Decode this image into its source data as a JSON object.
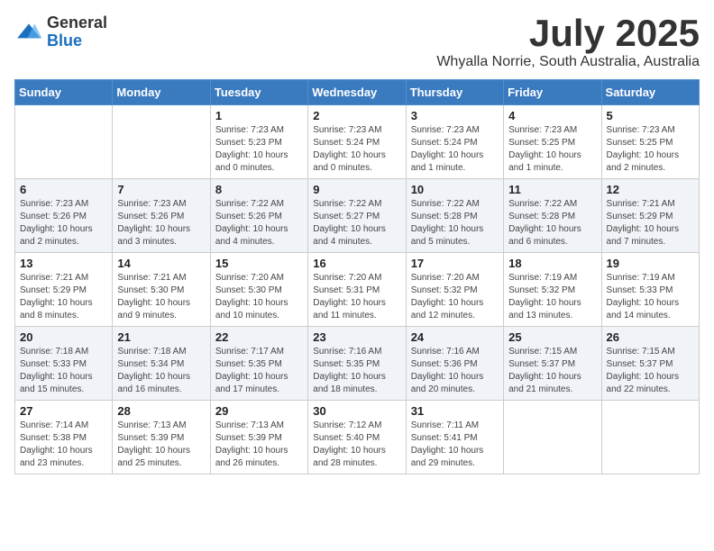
{
  "logo": {
    "general": "General",
    "blue": "Blue"
  },
  "title": {
    "month_year": "July 2025",
    "location": "Whyalla Norrie, South Australia, Australia"
  },
  "weekdays": [
    "Sunday",
    "Monday",
    "Tuesday",
    "Wednesday",
    "Thursday",
    "Friday",
    "Saturday"
  ],
  "weeks": [
    [
      {
        "day": "",
        "sunrise": "",
        "sunset": "",
        "daylight": ""
      },
      {
        "day": "",
        "sunrise": "",
        "sunset": "",
        "daylight": ""
      },
      {
        "day": "1",
        "sunrise": "Sunrise: 7:23 AM",
        "sunset": "Sunset: 5:23 PM",
        "daylight": "Daylight: 10 hours and 0 minutes."
      },
      {
        "day": "2",
        "sunrise": "Sunrise: 7:23 AM",
        "sunset": "Sunset: 5:24 PM",
        "daylight": "Daylight: 10 hours and 0 minutes."
      },
      {
        "day": "3",
        "sunrise": "Sunrise: 7:23 AM",
        "sunset": "Sunset: 5:24 PM",
        "daylight": "Daylight: 10 hours and 1 minute."
      },
      {
        "day": "4",
        "sunrise": "Sunrise: 7:23 AM",
        "sunset": "Sunset: 5:25 PM",
        "daylight": "Daylight: 10 hours and 1 minute."
      },
      {
        "day": "5",
        "sunrise": "Sunrise: 7:23 AM",
        "sunset": "Sunset: 5:25 PM",
        "daylight": "Daylight: 10 hours and 2 minutes."
      }
    ],
    [
      {
        "day": "6",
        "sunrise": "Sunrise: 7:23 AM",
        "sunset": "Sunset: 5:26 PM",
        "daylight": "Daylight: 10 hours and 2 minutes."
      },
      {
        "day": "7",
        "sunrise": "Sunrise: 7:23 AM",
        "sunset": "Sunset: 5:26 PM",
        "daylight": "Daylight: 10 hours and 3 minutes."
      },
      {
        "day": "8",
        "sunrise": "Sunrise: 7:22 AM",
        "sunset": "Sunset: 5:26 PM",
        "daylight": "Daylight: 10 hours and 4 minutes."
      },
      {
        "day": "9",
        "sunrise": "Sunrise: 7:22 AM",
        "sunset": "Sunset: 5:27 PM",
        "daylight": "Daylight: 10 hours and 4 minutes."
      },
      {
        "day": "10",
        "sunrise": "Sunrise: 7:22 AM",
        "sunset": "Sunset: 5:28 PM",
        "daylight": "Daylight: 10 hours and 5 minutes."
      },
      {
        "day": "11",
        "sunrise": "Sunrise: 7:22 AM",
        "sunset": "Sunset: 5:28 PM",
        "daylight": "Daylight: 10 hours and 6 minutes."
      },
      {
        "day": "12",
        "sunrise": "Sunrise: 7:21 AM",
        "sunset": "Sunset: 5:29 PM",
        "daylight": "Daylight: 10 hours and 7 minutes."
      }
    ],
    [
      {
        "day": "13",
        "sunrise": "Sunrise: 7:21 AM",
        "sunset": "Sunset: 5:29 PM",
        "daylight": "Daylight: 10 hours and 8 minutes."
      },
      {
        "day": "14",
        "sunrise": "Sunrise: 7:21 AM",
        "sunset": "Sunset: 5:30 PM",
        "daylight": "Daylight: 10 hours and 9 minutes."
      },
      {
        "day": "15",
        "sunrise": "Sunrise: 7:20 AM",
        "sunset": "Sunset: 5:30 PM",
        "daylight": "Daylight: 10 hours and 10 minutes."
      },
      {
        "day": "16",
        "sunrise": "Sunrise: 7:20 AM",
        "sunset": "Sunset: 5:31 PM",
        "daylight": "Daylight: 10 hours and 11 minutes."
      },
      {
        "day": "17",
        "sunrise": "Sunrise: 7:20 AM",
        "sunset": "Sunset: 5:32 PM",
        "daylight": "Daylight: 10 hours and 12 minutes."
      },
      {
        "day": "18",
        "sunrise": "Sunrise: 7:19 AM",
        "sunset": "Sunset: 5:32 PM",
        "daylight": "Daylight: 10 hours and 13 minutes."
      },
      {
        "day": "19",
        "sunrise": "Sunrise: 7:19 AM",
        "sunset": "Sunset: 5:33 PM",
        "daylight": "Daylight: 10 hours and 14 minutes."
      }
    ],
    [
      {
        "day": "20",
        "sunrise": "Sunrise: 7:18 AM",
        "sunset": "Sunset: 5:33 PM",
        "daylight": "Daylight: 10 hours and 15 minutes."
      },
      {
        "day": "21",
        "sunrise": "Sunrise: 7:18 AM",
        "sunset": "Sunset: 5:34 PM",
        "daylight": "Daylight: 10 hours and 16 minutes."
      },
      {
        "day": "22",
        "sunrise": "Sunrise: 7:17 AM",
        "sunset": "Sunset: 5:35 PM",
        "daylight": "Daylight: 10 hours and 17 minutes."
      },
      {
        "day": "23",
        "sunrise": "Sunrise: 7:16 AM",
        "sunset": "Sunset: 5:35 PM",
        "daylight": "Daylight: 10 hours and 18 minutes."
      },
      {
        "day": "24",
        "sunrise": "Sunrise: 7:16 AM",
        "sunset": "Sunset: 5:36 PM",
        "daylight": "Daylight: 10 hours and 20 minutes."
      },
      {
        "day": "25",
        "sunrise": "Sunrise: 7:15 AM",
        "sunset": "Sunset: 5:37 PM",
        "daylight": "Daylight: 10 hours and 21 minutes."
      },
      {
        "day": "26",
        "sunrise": "Sunrise: 7:15 AM",
        "sunset": "Sunset: 5:37 PM",
        "daylight": "Daylight: 10 hours and 22 minutes."
      }
    ],
    [
      {
        "day": "27",
        "sunrise": "Sunrise: 7:14 AM",
        "sunset": "Sunset: 5:38 PM",
        "daylight": "Daylight: 10 hours and 23 minutes."
      },
      {
        "day": "28",
        "sunrise": "Sunrise: 7:13 AM",
        "sunset": "Sunset: 5:39 PM",
        "daylight": "Daylight: 10 hours and 25 minutes."
      },
      {
        "day": "29",
        "sunrise": "Sunrise: 7:13 AM",
        "sunset": "Sunset: 5:39 PM",
        "daylight": "Daylight: 10 hours and 26 minutes."
      },
      {
        "day": "30",
        "sunrise": "Sunrise: 7:12 AM",
        "sunset": "Sunset: 5:40 PM",
        "daylight": "Daylight: 10 hours and 28 minutes."
      },
      {
        "day": "31",
        "sunrise": "Sunrise: 7:11 AM",
        "sunset": "Sunset: 5:41 PM",
        "daylight": "Daylight: 10 hours and 29 minutes."
      },
      {
        "day": "",
        "sunrise": "",
        "sunset": "",
        "daylight": ""
      },
      {
        "day": "",
        "sunrise": "",
        "sunset": "",
        "daylight": ""
      }
    ]
  ]
}
